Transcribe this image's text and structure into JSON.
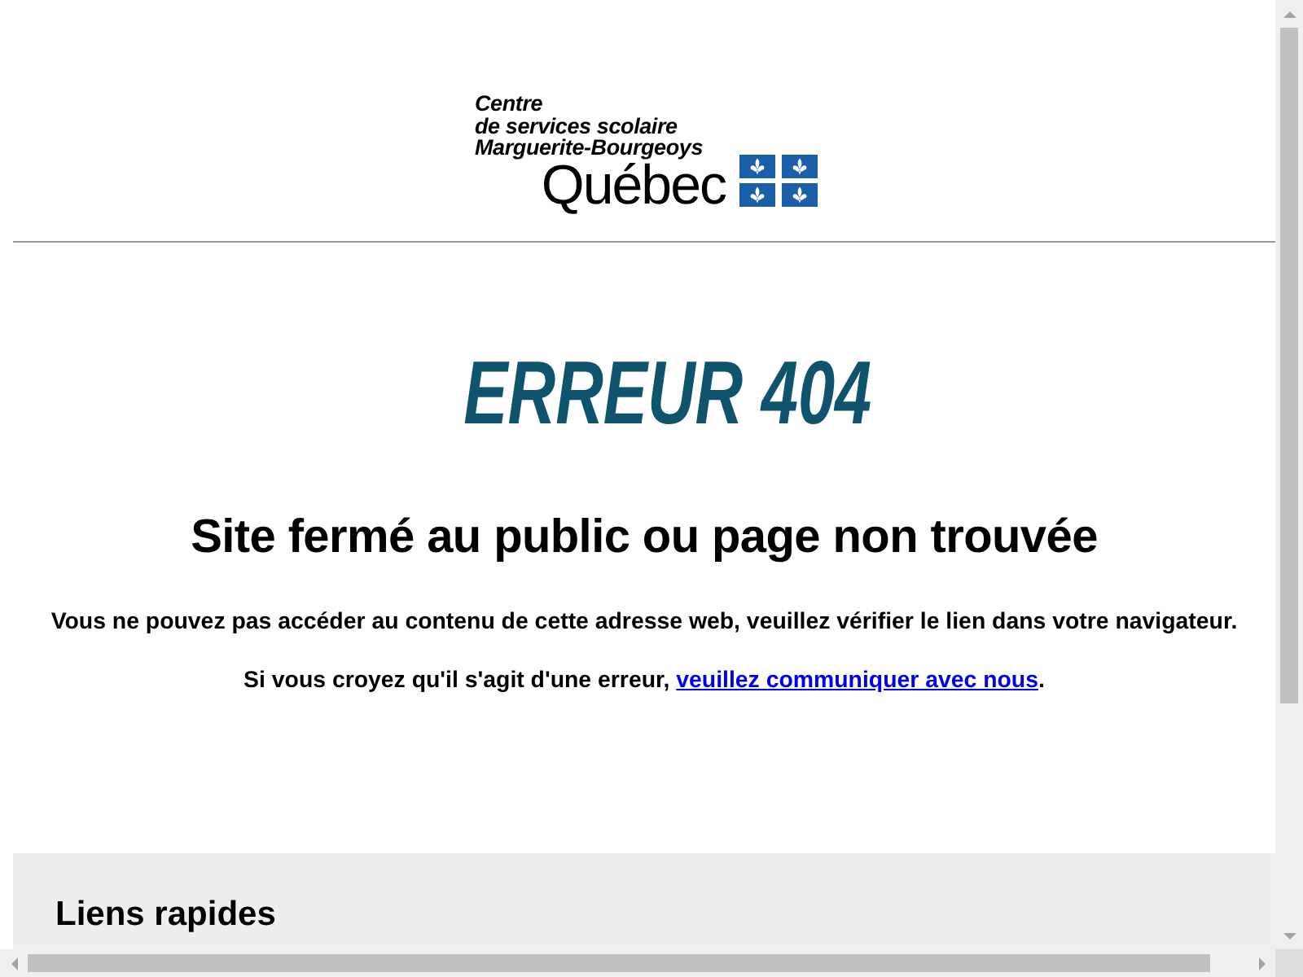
{
  "header": {
    "logo": {
      "lines": [
        "Centre",
        "de services scolaire",
        "Marguerite-Bourgeoys"
      ],
      "wordmark": "Québec"
    }
  },
  "error": {
    "code_title": "ERREUR 404",
    "heading": "Site fermé au public ou page non trouvée",
    "message": "Vous ne pouvez pas accéder au contenu de cette adresse web, veuillez vérifier le lien dans votre navigateur.",
    "contact": {
      "text_before": "Si vous croyez qu'il s'agit d'une erreur,",
      "link": "veuillez communiquer avec nous",
      "text_after": "."
    }
  },
  "footer": {
    "title": "Liens rapides"
  }
}
